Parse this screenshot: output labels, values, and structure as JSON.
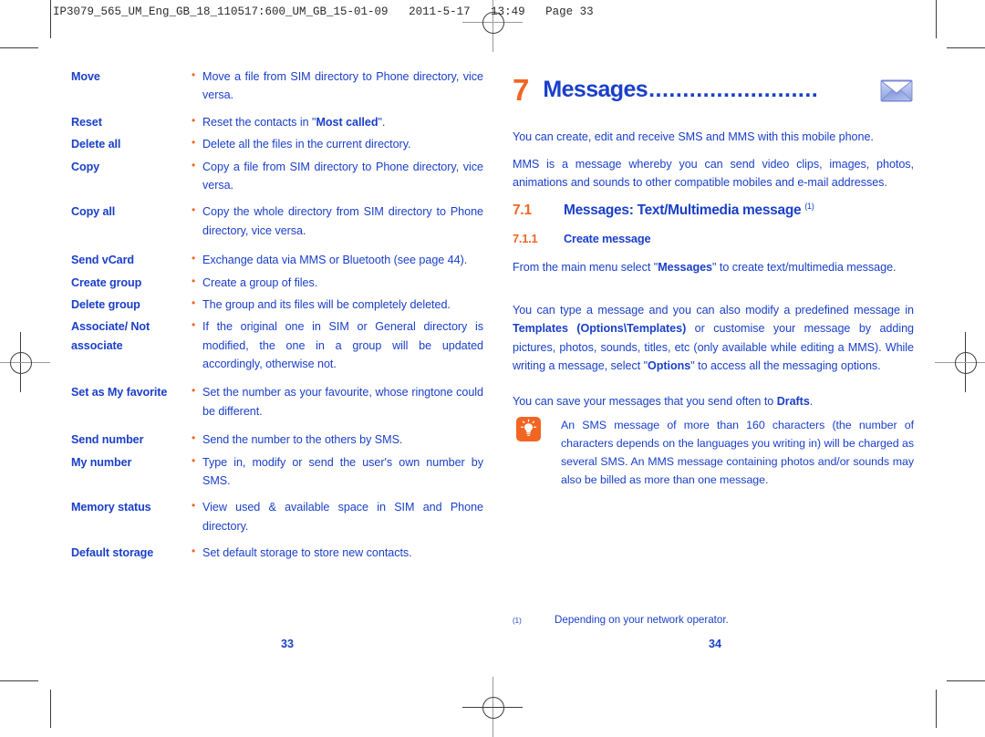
{
  "meta": {
    "slug": "IP3079_565_UM_Eng_GB_18_110517:600_UM_GB_15-01-09   2011-5-17   13:49   Page 33",
    "accent_blue": "#1A3FC9",
    "accent_orange": "#F26522"
  },
  "left_page": {
    "folio": "33",
    "definitions": [
      {
        "term": "Move",
        "desc": "Move a file from SIM directory to Phone directory, vice versa."
      },
      {
        "term": "Reset",
        "desc_pre": "Reset the contacts in \"",
        "desc_bold": "Most called",
        "desc_post": "\"."
      },
      {
        "term": "Delete all",
        "desc": "Delete all the files in the current directory."
      },
      {
        "term": "Copy",
        "desc": "Copy a file from SIM directory to Phone directory, vice versa."
      },
      {
        "term": "Copy all",
        "desc": "Copy the whole directory from SIM directory to Phone directory, vice versa."
      },
      {
        "term": "Send vCard",
        "desc": "Exchange data via MMS or Bluetooth (see page 44)."
      },
      {
        "term": "Create group",
        "desc": "Create a group of files."
      },
      {
        "term": "Delete group",
        "desc": "The group and its files will be completely deleted."
      },
      {
        "term": "Associate/ Not associate",
        "desc": "If the original one in SIM or General directory is modified, the one in a group will be updated accordingly, otherwise not."
      },
      {
        "term": "Set as My favorite",
        "desc": "Set the number as your favourite, whose ringtone could be different."
      },
      {
        "term": "Send number",
        "desc": "Send the number to the others by SMS."
      },
      {
        "term": "My number",
        "desc": "Type in, modify or send the user's own number by SMS."
      },
      {
        "term": "Memory status",
        "desc": "View used & available space in SIM and Phone directory."
      },
      {
        "term": "Default storage",
        "desc": "Set default storage to store new contacts."
      }
    ]
  },
  "right_page": {
    "folio": "34",
    "chapter": {
      "number": "7",
      "title": "Messages",
      "dots": ".........................",
      "icon": "envelope-icon"
    },
    "intro_1": "You can create, edit and receive SMS and MMS with this mobile phone.",
    "intro_2": "MMS is a message whereby you can send video clips, images, photos, animations and sounds to other compatible mobiles and e-mail addresses.",
    "heading_2": {
      "number": "7.1",
      "text": "Messages: Text/Multimedia message",
      "footnote_mark": "(1)"
    },
    "heading_3": {
      "number": "7.1.1",
      "text": "Create message"
    },
    "para_1": {
      "pre": "From the main menu select \"",
      "bold": "Messages",
      "post": "\" to create text/multimedia message."
    },
    "para_2": {
      "s1": "You can type a message and you can also modify a predefined message in ",
      "b1": "Templates (Options\\Templates)",
      "s2": " or customise your message by adding pictures, photos, sounds, titles, etc (only available while editing a MMS). While writing a message, select \"",
      "b2": "Options",
      "s3": "\" to access all the messaging options."
    },
    "para_3": {
      "pre": "You can save your messages that you send often to ",
      "bold": "Drafts",
      "post": "."
    },
    "tip": {
      "icon": "lightbulb-tip-icon",
      "text": "An SMS message of more than 160 characters (the number of characters depends on the languages you writing in) will be charged as several SMS. An MMS message containing photos and/or sounds may also be billed as more than one message."
    },
    "footnote": {
      "mark": "(1)",
      "text": "Depending on your network operator."
    }
  }
}
